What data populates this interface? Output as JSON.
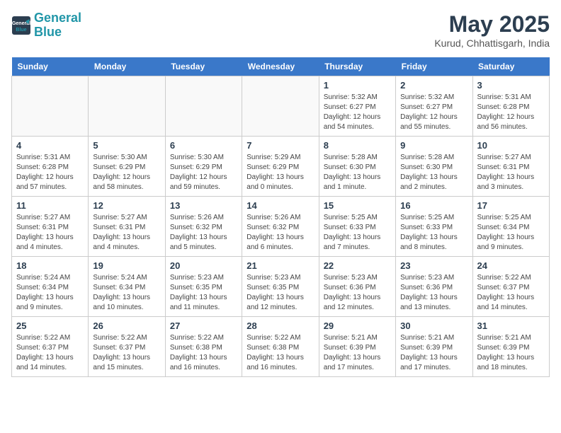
{
  "logo": {
    "line1": "General",
    "line2": "Blue"
  },
  "title": "May 2025",
  "location": "Kurud, Chhattisgarh, India",
  "weekdays": [
    "Sunday",
    "Monday",
    "Tuesday",
    "Wednesday",
    "Thursday",
    "Friday",
    "Saturday"
  ],
  "weeks": [
    [
      {
        "day": "",
        "info": ""
      },
      {
        "day": "",
        "info": ""
      },
      {
        "day": "",
        "info": ""
      },
      {
        "day": "",
        "info": ""
      },
      {
        "day": "1",
        "info": "Sunrise: 5:32 AM\nSunset: 6:27 PM\nDaylight: 12 hours\nand 54 minutes."
      },
      {
        "day": "2",
        "info": "Sunrise: 5:32 AM\nSunset: 6:27 PM\nDaylight: 12 hours\nand 55 minutes."
      },
      {
        "day": "3",
        "info": "Sunrise: 5:31 AM\nSunset: 6:28 PM\nDaylight: 12 hours\nand 56 minutes."
      }
    ],
    [
      {
        "day": "4",
        "info": "Sunrise: 5:31 AM\nSunset: 6:28 PM\nDaylight: 12 hours\nand 57 minutes."
      },
      {
        "day": "5",
        "info": "Sunrise: 5:30 AM\nSunset: 6:29 PM\nDaylight: 12 hours\nand 58 minutes."
      },
      {
        "day": "6",
        "info": "Sunrise: 5:30 AM\nSunset: 6:29 PM\nDaylight: 12 hours\nand 59 minutes."
      },
      {
        "day": "7",
        "info": "Sunrise: 5:29 AM\nSunset: 6:29 PM\nDaylight: 13 hours\nand 0 minutes."
      },
      {
        "day": "8",
        "info": "Sunrise: 5:28 AM\nSunset: 6:30 PM\nDaylight: 13 hours\nand 1 minute."
      },
      {
        "day": "9",
        "info": "Sunrise: 5:28 AM\nSunset: 6:30 PM\nDaylight: 13 hours\nand 2 minutes."
      },
      {
        "day": "10",
        "info": "Sunrise: 5:27 AM\nSunset: 6:31 PM\nDaylight: 13 hours\nand 3 minutes."
      }
    ],
    [
      {
        "day": "11",
        "info": "Sunrise: 5:27 AM\nSunset: 6:31 PM\nDaylight: 13 hours\nand 4 minutes."
      },
      {
        "day": "12",
        "info": "Sunrise: 5:27 AM\nSunset: 6:31 PM\nDaylight: 13 hours\nand 4 minutes."
      },
      {
        "day": "13",
        "info": "Sunrise: 5:26 AM\nSunset: 6:32 PM\nDaylight: 13 hours\nand 5 minutes."
      },
      {
        "day": "14",
        "info": "Sunrise: 5:26 AM\nSunset: 6:32 PM\nDaylight: 13 hours\nand 6 minutes."
      },
      {
        "day": "15",
        "info": "Sunrise: 5:25 AM\nSunset: 6:33 PM\nDaylight: 13 hours\nand 7 minutes."
      },
      {
        "day": "16",
        "info": "Sunrise: 5:25 AM\nSunset: 6:33 PM\nDaylight: 13 hours\nand 8 minutes."
      },
      {
        "day": "17",
        "info": "Sunrise: 5:25 AM\nSunset: 6:34 PM\nDaylight: 13 hours\nand 9 minutes."
      }
    ],
    [
      {
        "day": "18",
        "info": "Sunrise: 5:24 AM\nSunset: 6:34 PM\nDaylight: 13 hours\nand 9 minutes."
      },
      {
        "day": "19",
        "info": "Sunrise: 5:24 AM\nSunset: 6:34 PM\nDaylight: 13 hours\nand 10 minutes."
      },
      {
        "day": "20",
        "info": "Sunrise: 5:23 AM\nSunset: 6:35 PM\nDaylight: 13 hours\nand 11 minutes."
      },
      {
        "day": "21",
        "info": "Sunrise: 5:23 AM\nSunset: 6:35 PM\nDaylight: 13 hours\nand 12 minutes."
      },
      {
        "day": "22",
        "info": "Sunrise: 5:23 AM\nSunset: 6:36 PM\nDaylight: 13 hours\nand 12 minutes."
      },
      {
        "day": "23",
        "info": "Sunrise: 5:23 AM\nSunset: 6:36 PM\nDaylight: 13 hours\nand 13 minutes."
      },
      {
        "day": "24",
        "info": "Sunrise: 5:22 AM\nSunset: 6:37 PM\nDaylight: 13 hours\nand 14 minutes."
      }
    ],
    [
      {
        "day": "25",
        "info": "Sunrise: 5:22 AM\nSunset: 6:37 PM\nDaylight: 13 hours\nand 14 minutes."
      },
      {
        "day": "26",
        "info": "Sunrise: 5:22 AM\nSunset: 6:37 PM\nDaylight: 13 hours\nand 15 minutes."
      },
      {
        "day": "27",
        "info": "Sunrise: 5:22 AM\nSunset: 6:38 PM\nDaylight: 13 hours\nand 16 minutes."
      },
      {
        "day": "28",
        "info": "Sunrise: 5:22 AM\nSunset: 6:38 PM\nDaylight: 13 hours\nand 16 minutes."
      },
      {
        "day": "29",
        "info": "Sunrise: 5:21 AM\nSunset: 6:39 PM\nDaylight: 13 hours\nand 17 minutes."
      },
      {
        "day": "30",
        "info": "Sunrise: 5:21 AM\nSunset: 6:39 PM\nDaylight: 13 hours\nand 17 minutes."
      },
      {
        "day": "31",
        "info": "Sunrise: 5:21 AM\nSunset: 6:39 PM\nDaylight: 13 hours\nand 18 minutes."
      }
    ]
  ]
}
